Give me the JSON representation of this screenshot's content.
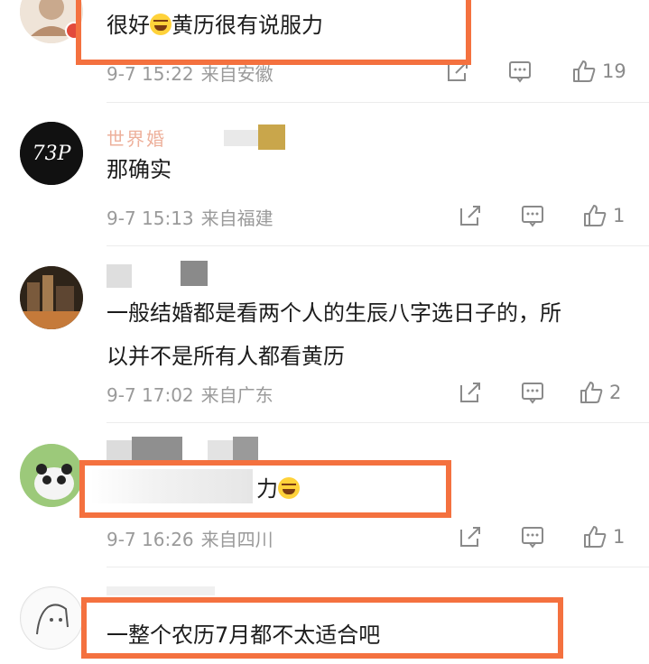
{
  "comments": [
    {
      "text": "很好😂黄历很有说服力",
      "text_before_emoji": "很好",
      "text_after_emoji": "黄历很有说服力",
      "date": "9-7 15:22",
      "location": "来自安徽",
      "likes": "19"
    },
    {
      "username_partial": "世界婚",
      "text": "那确实",
      "date": "9-7 15:13",
      "location": "来自福建",
      "likes": "1",
      "avatar_text": "73P"
    },
    {
      "text_line1": "一般结婚都是看两个人的生辰八字选日子的，所",
      "text_line2": "以并不是所有人都看黄历",
      "date": "9-7 17:02",
      "location": "来自广东",
      "likes": "2"
    },
    {
      "text_visible": "力",
      "date": "9-7 16:26",
      "location": "来自四川",
      "likes": "1"
    },
    {
      "text": "一整个农历7月都不太适合吧"
    }
  ],
  "icons": {
    "share": "share-icon",
    "comment": "comment-icon",
    "like": "like-icon"
  },
  "colors": {
    "highlight": "#f4713f",
    "meta": "#9a9a9a"
  }
}
